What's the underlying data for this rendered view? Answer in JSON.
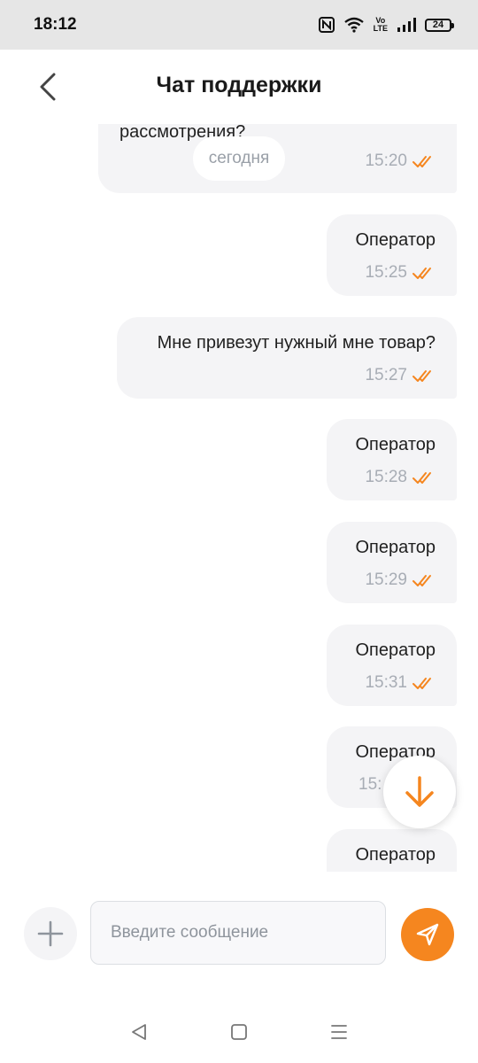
{
  "status_bar": {
    "time": "18:12",
    "volte_label": "Vo\nLTE",
    "battery_level": "24"
  },
  "header": {
    "title": "Чат поддержки"
  },
  "chat": {
    "date_chip": "сегодня",
    "messages": [
      {
        "text": "рассмотрения?",
        "time": "15:20"
      },
      {
        "text": "Оператор",
        "time": "15:25"
      },
      {
        "text": "Мне привезут нужный мне товар?",
        "time": "15:27"
      },
      {
        "text": "Оператор",
        "time": "15:28"
      },
      {
        "text": "Оператор",
        "time": "15:29"
      },
      {
        "text": "Оператор",
        "time": "15:31"
      },
      {
        "text": "Оператор",
        "time": "15:"
      },
      {
        "text": "Оператор",
        "time": ""
      }
    ]
  },
  "input": {
    "placeholder": "Введите сообщение",
    "value": ""
  },
  "colors": {
    "accent": "#f5861f",
    "bubble": "#f4f4f6",
    "time": "#a8adb5"
  },
  "icons": {
    "back": "chevron-left-icon",
    "read": "double-check-icon",
    "scroll": "arrow-down-icon",
    "attach": "plus-icon",
    "send": "send-icon"
  }
}
